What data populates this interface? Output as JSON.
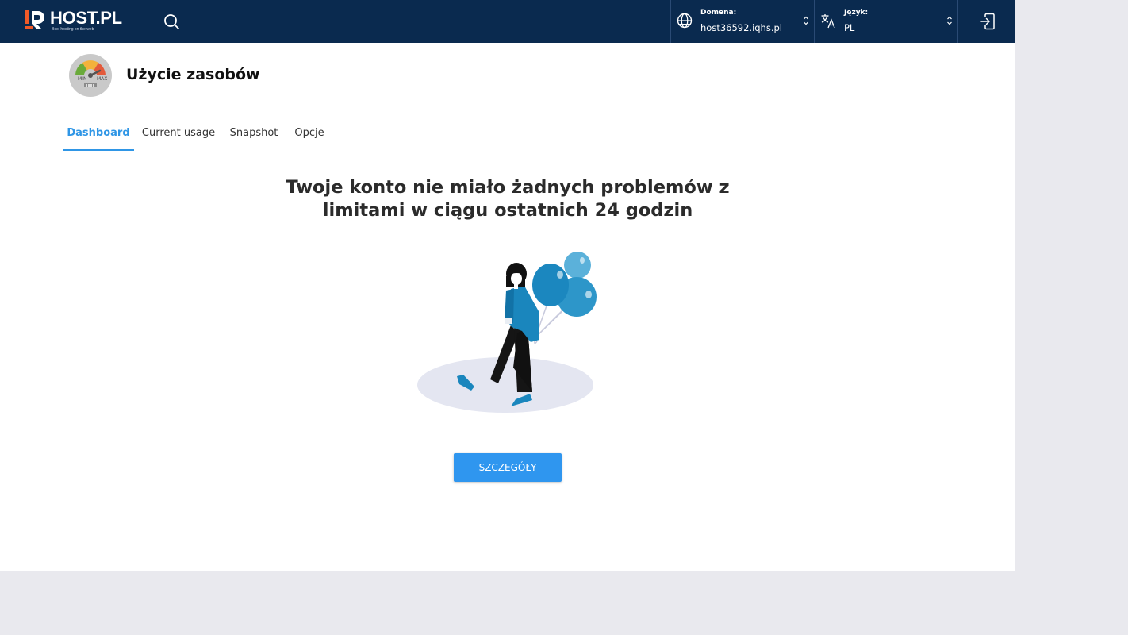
{
  "header": {
    "logo_text": "HOST.PL",
    "logo_tagline": "Best hosting on the web",
    "search_icon": "search-icon",
    "domain": {
      "label": "Domena:",
      "value": "host36592.iqhs.pl",
      "icon": "globe-icon"
    },
    "language": {
      "label": "Język:",
      "value": "PL",
      "icon": "translate-icon"
    },
    "logout_icon": "logout-icon",
    "colors": {
      "bar": "#0a2a4f",
      "logo_accent": "#f05a28"
    }
  },
  "page": {
    "title": "Użycie zasobów",
    "icon": "gauge-icon"
  },
  "tabs": [
    {
      "label": "Dashboard",
      "active": true
    },
    {
      "label": "Current usage",
      "active": false
    },
    {
      "label": "Snapshot",
      "active": false
    },
    {
      "label": "Opcje",
      "active": false
    }
  ],
  "main": {
    "headline": "Twoje konto nie miało żadnych problemów z limitami w ciągu ostatnich 24 godzin",
    "illustration": "woman-with-balloons-illustration",
    "details_button": "SZCZEGÓŁY",
    "accent_color": "#2f96ef"
  }
}
